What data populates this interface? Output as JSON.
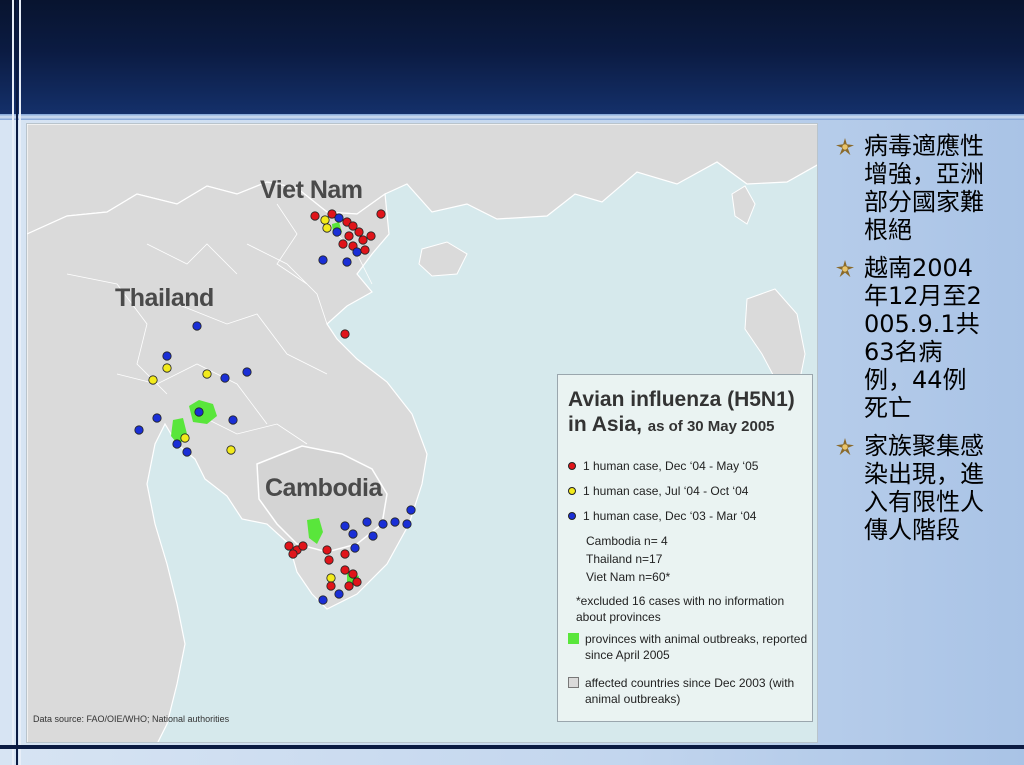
{
  "map": {
    "labels": {
      "vietnam": "Viet Nam",
      "thailand": "Thailand",
      "cambodia": "Cambodia"
    },
    "data_source": "Data source: FAO/OIE/WHO; National authorities",
    "colors": {
      "land": "#dadada",
      "sea": "#d6e9ec",
      "border": "#ffffff",
      "outbreak": "#59e63b",
      "red_case": "#e0141a",
      "yellow_case": "#f2ea1c",
      "blue_case": "#1a2fd6"
    }
  },
  "legend": {
    "title": "Avian influenza (H5N1) in Asia,",
    "title_line1": "Avian influenza (H5N1)",
    "title_line2": "in Asia,",
    "date": "as of 30 May 2005",
    "items": [
      {
        "color": "#e0141a",
        "label": "1 human case, Dec ‘04 - May ‘05"
      },
      {
        "color": "#f2ea1c",
        "label": "1 human case, Jul  ‘04 - Oct  ‘04"
      },
      {
        "color": "#1a2fd6",
        "label": "1 human case, Dec ‘03 - Mar ‘04"
      }
    ],
    "counts": [
      "Cambodia    n=  4",
      "Thailand     n=17",
      "Viet Nam    n=60*"
    ],
    "excluded_note": "*excluded 16 cases with no information about provinces",
    "outbreak_label": "provinces with animal outbreaks, reported since April 2005",
    "affected_label": "affected countries since Dec 2003 (with animal outbreaks)"
  },
  "bullets": [
    {
      "icon": "star-bullet-icon",
      "text": "病毒適應性增強，亞洲部分國家難根絕"
    },
    {
      "icon": "star-bullet-icon",
      "text": "越南2004年12月至2005.9.1共63名病例，44例死亡"
    },
    {
      "icon": "star-bullet-icon",
      "text": "家族聚集感染出現，進入有限性人傳人階段"
    }
  ]
}
